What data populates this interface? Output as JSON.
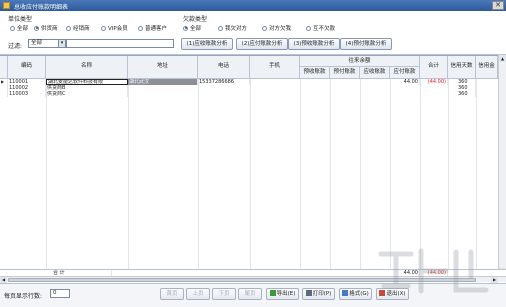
{
  "window": {
    "title": "总收应付账款明细表",
    "close_glyph": "✕"
  },
  "unit_type": {
    "title": "单位类型",
    "options": [
      {
        "label": "全部",
        "selected": false
      },
      {
        "label": "供货商",
        "selected": true
      },
      {
        "label": "经销商",
        "selected": false
      },
      {
        "label": "VIP会员",
        "selected": false
      },
      {
        "label": "普通客户",
        "selected": false
      }
    ]
  },
  "debt_type": {
    "title": "欠款类型",
    "options": [
      {
        "label": "全部",
        "selected": true
      },
      {
        "label": "我欠对方",
        "selected": false
      },
      {
        "label": "对方欠我",
        "selected": false
      },
      {
        "label": "互不欠款",
        "selected": false
      }
    ]
  },
  "filter": {
    "label": "过滤:",
    "value": "全部",
    "arrow": "▾"
  },
  "analysis_buttons": [
    "(1)应收账款分析",
    "(2)应付账款分析",
    "(3)预收账款分析",
    "(4)预付账款分析"
  ],
  "table": {
    "headers": {
      "code": "编码",
      "name": "名称",
      "address": "地址",
      "phone": "电话",
      "mobile": "手机",
      "group": "往来余额",
      "prepaid_recv": "预收账款",
      "prepaid_pay": "预付账款",
      "acct_recv": "应收账款",
      "acct_pay": "应付账款",
      "total": "合计",
      "credit_days": "信用天数",
      "credit_limit": "信用金"
    },
    "rows": [
      {
        "marker": "▶",
        "code": "110001",
        "name": "湖北麦能达软件科技有限",
        "address": "湖北武汉",
        "phone": "15337286686",
        "acct_pay": "44.00",
        "total": "(44.00)",
        "credit_days": "360"
      },
      {
        "marker": "",
        "code": "110002",
        "name": "供货商B",
        "address": "",
        "phone": "",
        "acct_pay": "",
        "total": "",
        "credit_days": "360"
      },
      {
        "marker": "",
        "code": "110003",
        "name": "供货商C",
        "address": "",
        "phone": "",
        "acct_pay": "",
        "total": "",
        "credit_days": "360"
      }
    ],
    "totals": {
      "label": "合 计",
      "acct_pay": "44.00",
      "total": "(44.00)"
    }
  },
  "pager": {
    "label": "每页显示行数:",
    "value": "0"
  },
  "nav_buttons": [
    "首页",
    "上页",
    "下页",
    "尾页"
  ],
  "action_buttons": [
    "导出(E)",
    "打印(P)",
    "格式(G)",
    "退出(X)"
  ],
  "scroll_glyphs": {
    "left": "◀",
    "right": "▶",
    "up": "▲",
    "down": "▼"
  },
  "colors": {
    "title_bar": "#2d5a9a",
    "negative": "#e02020",
    "header_bg": "#eef2f7"
  }
}
